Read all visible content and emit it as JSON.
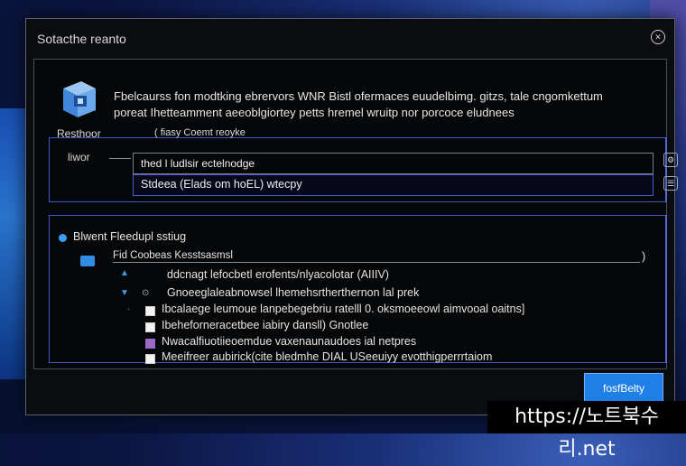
{
  "window": {
    "title": "Sotacthe reanto"
  },
  "header": {
    "description_line1": "Fbelcaurss fon modtking ebrervors WNR Bistl ofermaces euudelbimg. gitzs, tale cngomkettum",
    "description_line2": "poreat Ihetteamment aeeoblgiortey petts hremel wruitp nor porcoce eludnees"
  },
  "entry": {
    "row1_label": "Resthoor",
    "row1_hint": "( fiasy Coemt reoyke",
    "row2_label": "liwor",
    "input_value": "thed l ludlsir ectelnodge",
    "browse_value": "Stdeea (Elads om hoEL) wtecpy"
  },
  "options": {
    "heading": "Blwent Fleedupl sstiug",
    "tree_root": "Fid Coobeas Kesstsasmsl",
    "items": [
      "ddcnagt lefocbetl erofents/nlyacolotar (AIIIV)",
      "Gnoeeglaleabnowsel lhemehsrtherthernon lal prek",
      "Ibcalaege leumoue lanpebegebriu ratelll 0. oksmoeeowl aimvooal oaitns]",
      "Ibeheforneracetbee iabiry dansll) Gnotlee",
      "Nwacalfiuotiieoemdue vaxenaunaudoes ial netpres",
      "Meeifreer aubirick(cite bledmhe DIAL USeeuiyy evotthigperrrtaiom"
    ]
  },
  "footer": {
    "primary_button": "fosfBelty"
  },
  "watermark": "https://노트북수리.net",
  "colors": {
    "accent": "#1f7fe6",
    "frame": "#3f56c8",
    "dialog_bg": "#0b0c10"
  }
}
